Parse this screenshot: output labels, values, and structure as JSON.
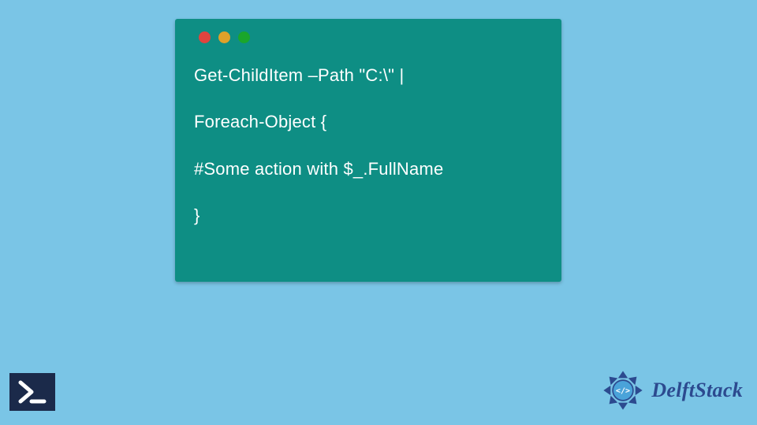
{
  "code": {
    "lines": [
      "Get-ChildItem –Path \"C:\\\" |",
      "",
      "Foreach-Object {",
      "",
      "#Some action with $_.FullName",
      "",
      "}"
    ]
  },
  "traffic_dots": [
    "red",
    "yellow",
    "green"
  ],
  "brand": {
    "name": "DelftStack"
  },
  "icons": {
    "powershell": "powershell-icon",
    "brand_logo": "delftstack-logo"
  },
  "colors": {
    "page_bg": "#7ac5e6",
    "card_bg": "#0e8e84",
    "code_text": "#ffffff",
    "brand_text": "#2c4a8f",
    "ps_bg": "#1b2a4a"
  }
}
